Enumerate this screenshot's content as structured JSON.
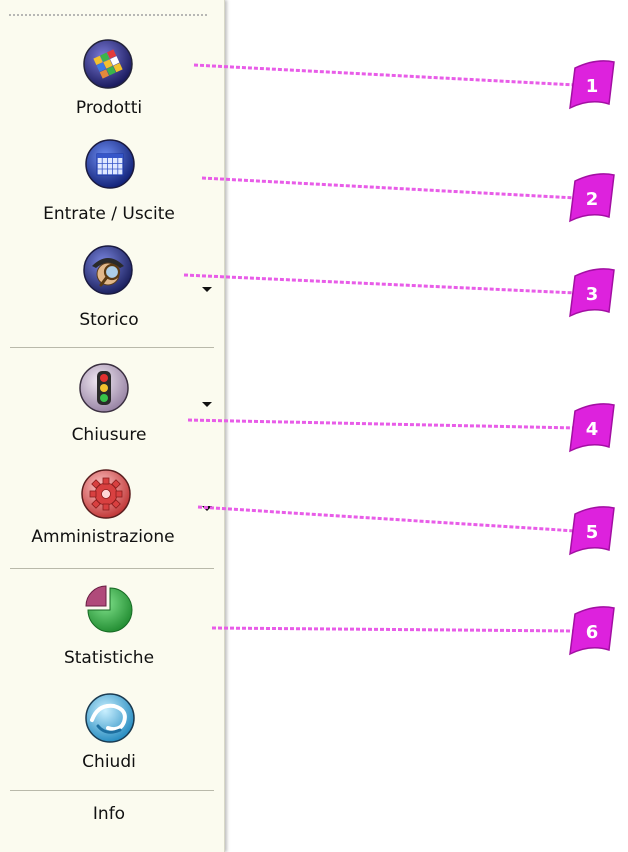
{
  "toolbar": {
    "buttons": [
      {
        "label": "Prodotti",
        "icon": "rubik-cube-icon",
        "has_dropdown": false
      },
      {
        "label": "Entrate / Uscite",
        "icon": "calendar-grid-icon",
        "has_dropdown": false
      },
      {
        "label": "Storico",
        "icon": "detective-magnifier-icon",
        "has_dropdown": true
      },
      {
        "label": "Chiusure",
        "icon": "traffic-light-icon",
        "has_dropdown": true
      },
      {
        "label": "Amministrazione",
        "icon": "red-gear-icon",
        "has_dropdown": true
      },
      {
        "label": "Statistiche",
        "icon": "pie-chart-icon",
        "has_dropdown": false
      },
      {
        "label": "Chiudi",
        "icon": "swirl-exit-icon",
        "has_dropdown": false
      }
    ],
    "info_label": "Info"
  },
  "callouts": {
    "color": "#e85ce8",
    "badge_color": "#dd22dd",
    "badges": [
      "1",
      "2",
      "3",
      "4",
      "5",
      "6"
    ]
  }
}
